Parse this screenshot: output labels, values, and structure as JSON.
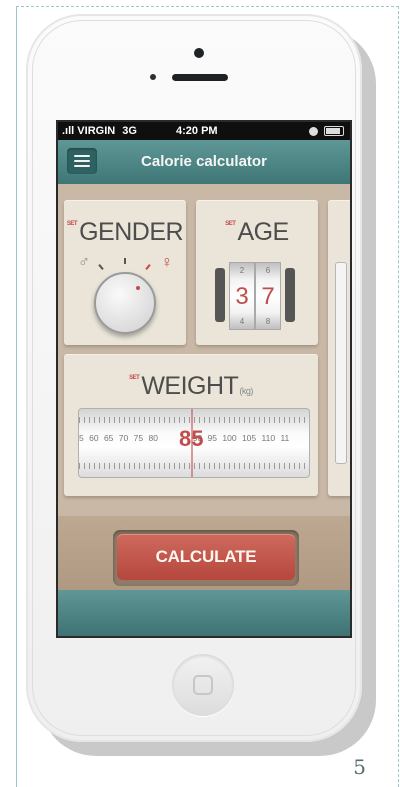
{
  "status_bar": {
    "carrier": "VIRGIN",
    "network": "3G",
    "time": "4:20 PM"
  },
  "navbar": {
    "title": "Calorie calculator",
    "menu_icon": "hamburger-icon"
  },
  "cards": {
    "set_label": "SET",
    "gender": {
      "title": "GENDER",
      "male_icon": "male-icon",
      "female_icon": "female-icon"
    },
    "age": {
      "title": "AGE",
      "digits": [
        "3",
        "7"
      ],
      "above": [
        "2",
        "6"
      ],
      "below": [
        "4",
        "8"
      ],
      "value": 37
    },
    "weight": {
      "title": "WEIGHT",
      "unit": "(kg)",
      "scale": [
        "5",
        "60",
        "65",
        "70",
        "75",
        "80",
        "85",
        "90",
        "95",
        "100",
        "105",
        "110",
        "11"
      ],
      "selected": "85"
    }
  },
  "actions": {
    "calculate_label": "CALCULATE"
  },
  "page": {
    "number": "5"
  },
  "colors": {
    "accent": "#c24b4b",
    "teal": "#4a8080",
    "sand": "#c9b8a6",
    "card": "#eae5d8"
  }
}
